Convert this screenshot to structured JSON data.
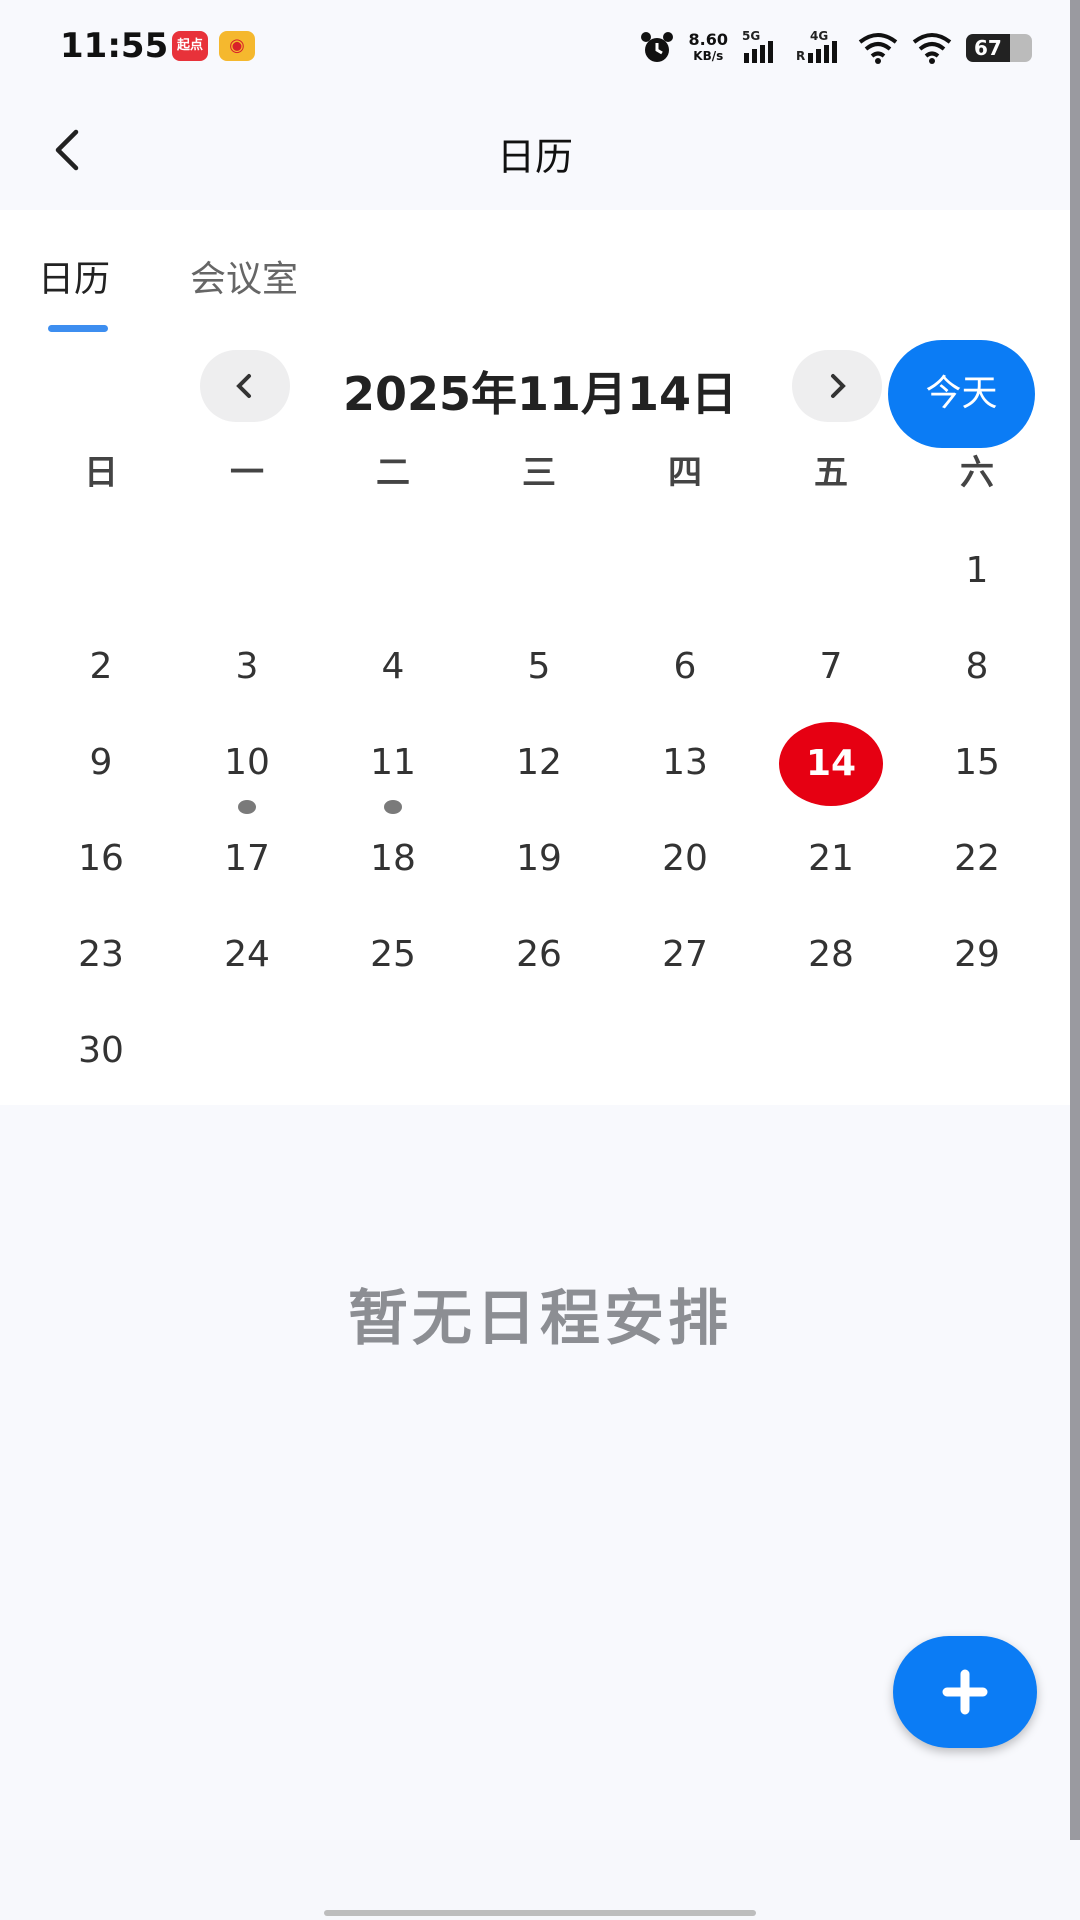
{
  "status_bar": {
    "time": "11:55",
    "app_badges": [
      "起点",
      "◉"
    ],
    "net_speed": "8.60",
    "net_speed_unit": "KB/s",
    "sim1": "5G",
    "sim2": "4G",
    "sim2_roaming": "R",
    "battery": "67"
  },
  "header": {
    "title": "日历",
    "back_icon": "chevron-left-icon"
  },
  "tabs": [
    {
      "label": "日历",
      "active": true
    },
    {
      "label": "会议室",
      "active": false
    }
  ],
  "month_nav": {
    "label": "2025年11月14日",
    "today_label": "今天"
  },
  "calendar": {
    "weekdays": [
      "日",
      "一",
      "二",
      "三",
      "四",
      "五",
      "六"
    ],
    "leading_blanks": 6,
    "days": [
      "1",
      "2",
      "3",
      "4",
      "5",
      "6",
      "7",
      "8",
      "9",
      "10",
      "11",
      "12",
      "13",
      "14",
      "15",
      "16",
      "17",
      "18",
      "19",
      "20",
      "21",
      "22",
      "23",
      "24",
      "25",
      "26",
      "27",
      "28",
      "29",
      "30"
    ],
    "selected_day": "14",
    "days_with_events": [
      "10",
      "11"
    ]
  },
  "empty_state": "暂无日程安排",
  "fab": {
    "icon": "plus-icon"
  },
  "colors": {
    "accent": "#0b7cf5",
    "today": "#e60012",
    "tab_indicator": "#3d8ef0"
  }
}
